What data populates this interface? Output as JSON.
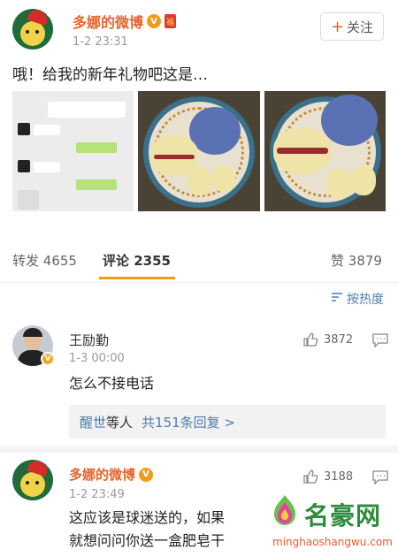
{
  "post": {
    "author": "多娜的微博",
    "time": "1-2 23:31",
    "follow_label": "关注",
    "follow_plus": "+",
    "text": "哦！给我的新年礼物吧这是…",
    "vip_badge": "V",
    "redpack_badge": "福"
  },
  "stats": {
    "repost_label": "转发",
    "repost_count": "4655",
    "comment_label": "评论",
    "comment_count": "2355",
    "like_label": "赞",
    "like_count": "3879"
  },
  "sort": {
    "label": "按热度"
  },
  "comments": [
    {
      "name": "王励勤",
      "time": "1-3 00:00",
      "text": "怎么不接电话",
      "likes": "3872",
      "verified_badge": "V",
      "replies_user": "醒世",
      "replies_suffix": "等人",
      "replies_link": "共151条回复 >"
    },
    {
      "name": "多娜的微博",
      "time": "1-2 23:49",
      "text_line1": "这应该是球迷送的，如果",
      "text_line2": "就想问问你送一盒肥皂干",
      "likes": "3188",
      "vip_badge": "V"
    }
  ],
  "watermark": {
    "title": "名豪网",
    "url": "minghaoshangwu.com"
  },
  "colors": {
    "accent": "#e8632c",
    "link": "#507daf",
    "tab_indicator": "#f29a1a"
  }
}
